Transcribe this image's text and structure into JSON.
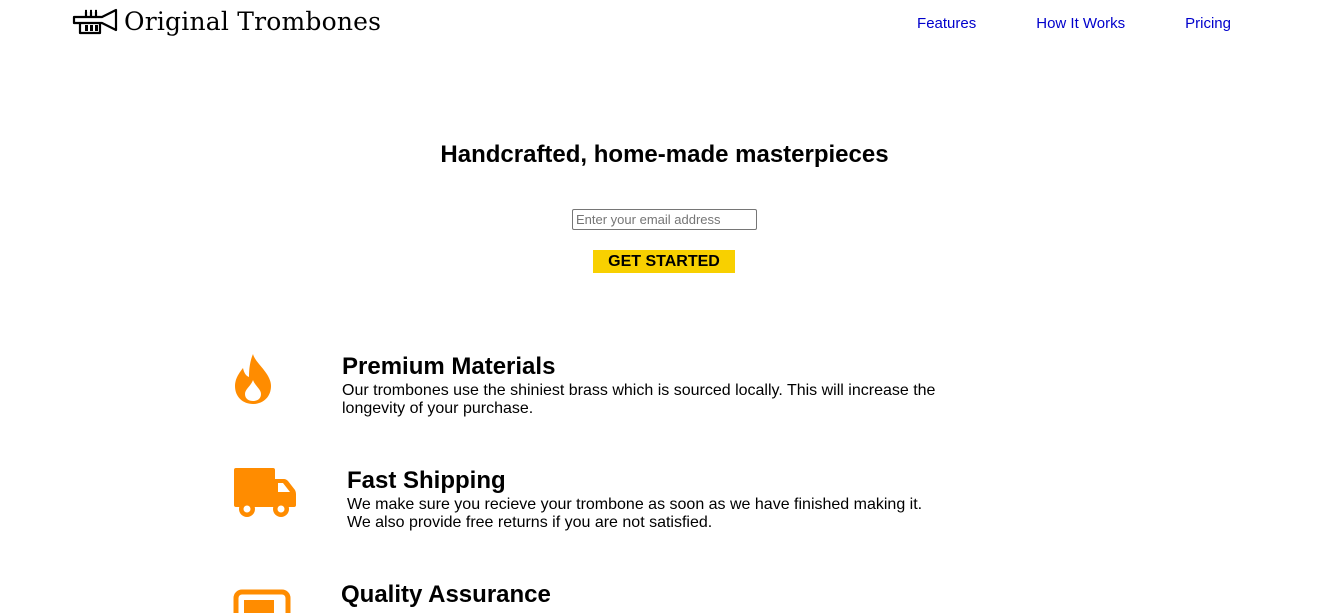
{
  "header": {
    "brand": "Original Trombones",
    "logo_icon": "trumpet-icon",
    "nav": [
      {
        "label": "Features"
      },
      {
        "label": "How It Works"
      },
      {
        "label": "Pricing"
      }
    ]
  },
  "hero": {
    "title": "Handcrafted, home-made masterpieces",
    "email_placeholder": "Enter your email address",
    "cta_label": "GET STARTED"
  },
  "features": [
    {
      "icon": "fire-icon",
      "title": "Premium Materials",
      "line1": "Our trombones use the shiniest brass which is sourced locally. This will increase the",
      "line2": "longevity of your purchase."
    },
    {
      "icon": "truck-icon",
      "title": "Fast Shipping",
      "line1": "We make sure you recieve your trombone as soon as we have finished making it.",
      "line2": "We also provide free returns if you are not satisfied."
    },
    {
      "icon": "battery-icon",
      "title": "Quality Assurance"
    }
  ],
  "colors": {
    "accent": "#ff8c00",
    "cta": "#f8d000",
    "link": "#0000cc"
  }
}
